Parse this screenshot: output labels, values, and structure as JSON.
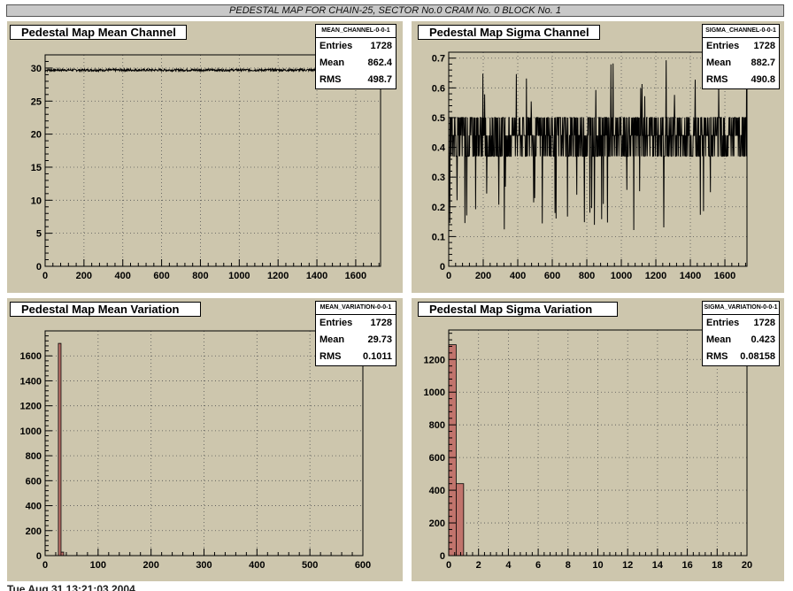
{
  "banner": "PEDESTAL MAP FOR CHAIN-25, SECTOR No.0 CRAM No. 0 BLOCK No. 1",
  "footer": "Tue Aug 31 13:21:03 2004",
  "colors": {
    "pad_bg": "#cdc6ad",
    "line": "#000000",
    "bar_fill": "#c1746c",
    "grid": "#555555"
  },
  "panels": [
    {
      "title": "Pedestal Map Mean Channel",
      "stats": {
        "name": "MEAN_CHANNEL-0-0-1",
        "entries": "1728",
        "mean": "862.4",
        "rms": "498.7"
      }
    },
    {
      "title": "Pedestal Map Sigma Channel",
      "stats": {
        "name": "SIGMA_CHANNEL-0-0-1",
        "entries": "1728",
        "mean": "882.7",
        "rms": "490.8"
      }
    },
    {
      "title": "Pedestal Map Mean Variation",
      "stats": {
        "name": "MEAN_VARIATION-0-0-1",
        "entries": "1728",
        "mean": "29.73",
        "rms": "0.1011"
      }
    },
    {
      "title": "Pedestal Map Sigma Variation",
      "stats": {
        "name": "SIGMA_VARIATION-0-0-1",
        "entries": "1728",
        "mean": "0.423",
        "rms": "0.08158"
      }
    }
  ],
  "stat_labels": {
    "entries": "Entries",
    "mean": "Mean",
    "rms": "RMS"
  },
  "chart_data": [
    {
      "type": "line",
      "title": "Pedestal Map Mean Channel",
      "xlim": [
        0,
        1728
      ],
      "ylim": [
        0,
        32
      ],
      "grid": true,
      "xticks": [
        0,
        200,
        400,
        600,
        800,
        1000,
        1200,
        1400,
        1600
      ],
      "yticks": [
        0,
        5,
        10,
        15,
        20,
        25,
        30
      ],
      "series": [
        {
          "values_summary": "approximately constant at 29.7 with small noise (RMS 0.10) for all 1728 channels",
          "level": 29.7
        }
      ]
    },
    {
      "type": "line",
      "title": "Pedestal Map Sigma Channel",
      "xlim": [
        0,
        1728
      ],
      "ylim": [
        0,
        0.72
      ],
      "grid": true,
      "xticks": [
        0,
        200,
        400,
        600,
        800,
        1000,
        1200,
        1400,
        1600
      ],
      "yticks": [
        0,
        0.1,
        0.2,
        0.3,
        0.4,
        0.5,
        0.6,
        0.7
      ],
      "series": [
        {
          "values_summary": "values fluctuate mostly between 0.37 and 0.50, occasional excursions to 0.12 and 0.70",
          "levels": [
            0.37,
            0.44,
            0.5
          ],
          "min": 0.12,
          "max": 0.7
        }
      ]
    },
    {
      "type": "bar",
      "title": "Pedestal Map Mean Variation",
      "xlim": [
        0,
        600
      ],
      "ylim": [
        0,
        1800
      ],
      "grid": true,
      "xticks": [
        0,
        100,
        200,
        300,
        400,
        500,
        600
      ],
      "yticks": [
        0,
        200,
        400,
        600,
        800,
        1000,
        1200,
        1400,
        1600
      ],
      "bins": [
        {
          "x0": 25,
          "x1": 30,
          "value": 1700
        },
        {
          "x0": 30,
          "x1": 35,
          "value": 28
        }
      ]
    },
    {
      "type": "bar",
      "title": "Pedestal Map Sigma Variation",
      "xlim": [
        0,
        20
      ],
      "ylim": [
        0,
        1380
      ],
      "grid": true,
      "xticks": [
        0,
        2,
        4,
        6,
        8,
        10,
        12,
        14,
        16,
        18,
        20
      ],
      "yticks": [
        0,
        200,
        400,
        600,
        800,
        1000,
        1200
      ],
      "bins": [
        {
          "x0": 0,
          "x1": 0.5,
          "value": 1290
        },
        {
          "x0": 0.5,
          "x1": 1.0,
          "value": 440
        }
      ]
    }
  ]
}
